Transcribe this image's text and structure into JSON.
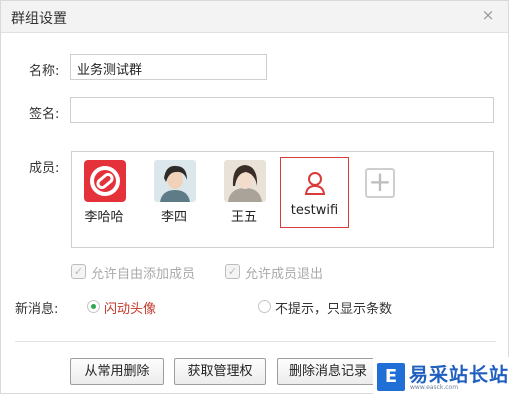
{
  "dialog": {
    "title": "群组设置",
    "close_symbol": "×"
  },
  "form": {
    "name_label": "名称:",
    "name_value": "业务测试群",
    "signature_label": "签名:",
    "signature_value": "",
    "members_label": "成员:"
  },
  "members": [
    {
      "name": "李哈哈",
      "icon": "red-link-icon"
    },
    {
      "name": "李四",
      "icon": "male-avatar-icon"
    },
    {
      "name": "王五",
      "icon": "female-avatar-icon"
    },
    {
      "name": "testwifi",
      "icon": "user-outline-icon",
      "selected": true
    }
  ],
  "add_member_symbol": "+",
  "options": {
    "allow_free_add": "允许自由添加成员",
    "allow_member_exit": "允许成员退出"
  },
  "new_message": {
    "label": "新消息:",
    "option_flash": "闪动头像",
    "option_no_prompt": "不提示，只显示条数",
    "selected": "闪动头像",
    "accent_color": "#2fa84f",
    "selected_text_color": "#c0392b"
  },
  "buttons": {
    "remove_common": "从常用删除",
    "get_admin": "获取管理权",
    "delete_history": "删除消息记录"
  },
  "watermark": {
    "mark": "E",
    "brand": "易采站长站",
    "url": "www.easck.com"
  }
}
